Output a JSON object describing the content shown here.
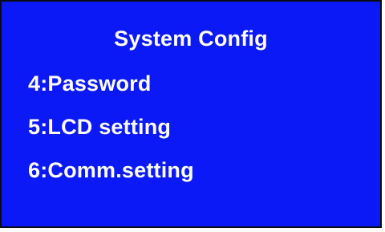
{
  "screen": {
    "title": "System Config",
    "background_color": "#0a19f5",
    "text_color": "#ffffff",
    "menu": [
      {
        "label": "4:Password"
      },
      {
        "label": "5:LCD setting"
      },
      {
        "label": "6:Comm.setting"
      }
    ]
  }
}
